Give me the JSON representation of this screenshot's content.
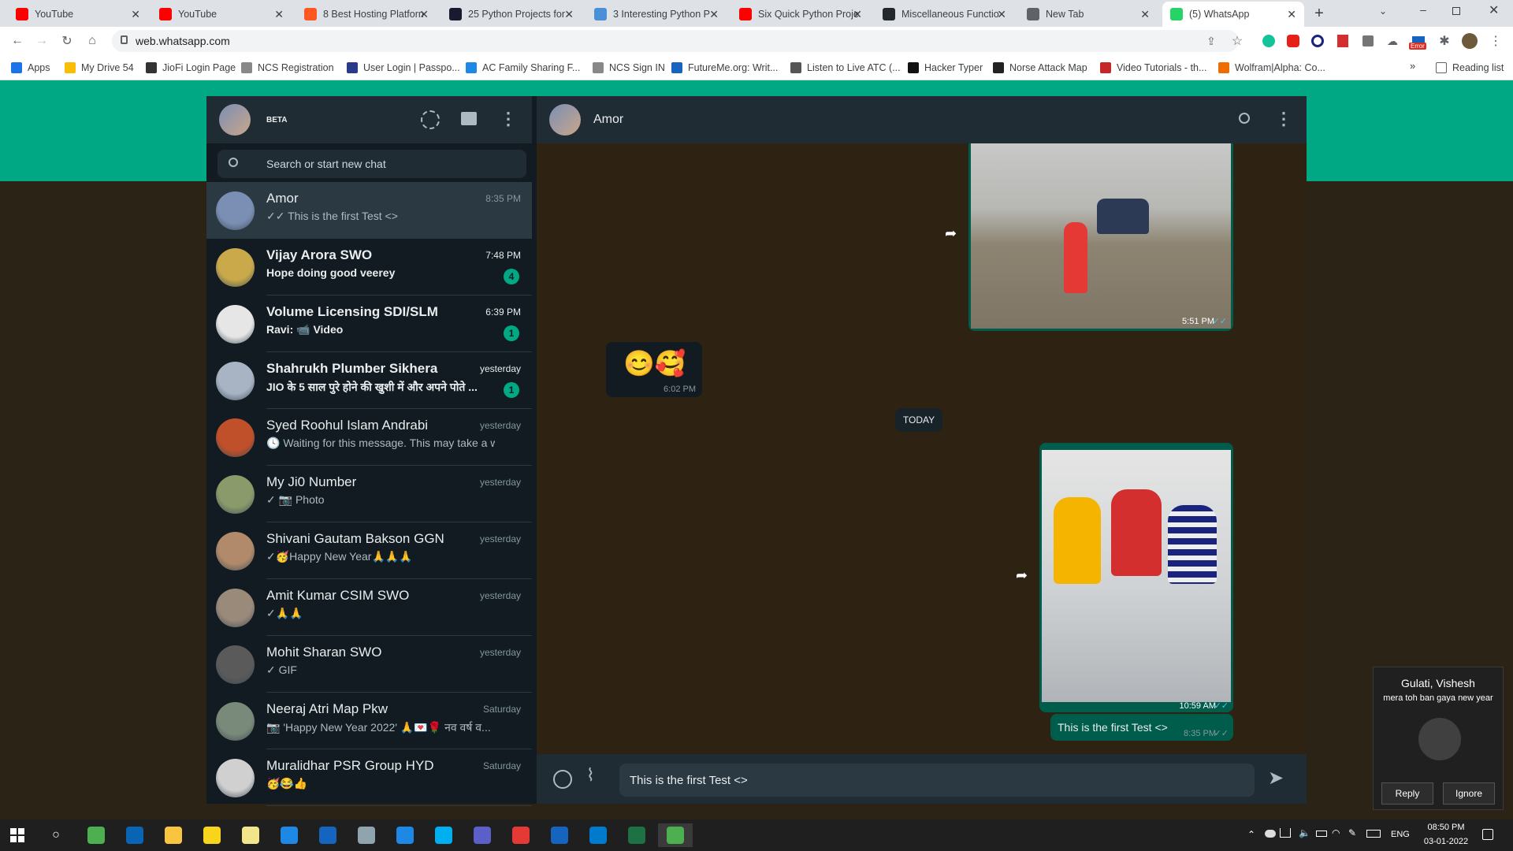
{
  "browser": {
    "tabs": [
      {
        "title": "YouTube",
        "favicon": "youtube-icon",
        "color": "#ff0000"
      },
      {
        "title": "YouTube",
        "favicon": "youtube-icon",
        "color": "#ff0000"
      },
      {
        "title": "8 Best Hosting Platforn",
        "favicon": "hosting-icon",
        "color": "#ff5722"
      },
      {
        "title": "25 Python Projects for",
        "favicon": "python-projects-icon",
        "color": "#1a1a2e"
      },
      {
        "title": "3 Interesting Python P",
        "favicon": "medium-icon",
        "color": "#4a90d9"
      },
      {
        "title": "Six Quick Python Proje",
        "favicon": "youtube-icon",
        "color": "#ff0000"
      },
      {
        "title": "Miscellaneous Functio",
        "favicon": "github-icon",
        "color": "#24292e"
      },
      {
        "title": "New Tab",
        "favicon": "chrome-icon",
        "color": "#5f6368"
      },
      {
        "title": "(5) WhatsApp",
        "favicon": "whatsapp-icon",
        "color": "#25d366"
      }
    ],
    "url": "web.whatsapp.com",
    "bookmarks": [
      {
        "label": "Apps",
        "color": "#1a73e8"
      },
      {
        "label": "My Drive 54",
        "color": "#fbbc04"
      },
      {
        "label": "JioFi Login Page",
        "color": "#333333"
      },
      {
        "label": "NCS Registration",
        "color": "#888888"
      },
      {
        "label": "User Login | Passpo...",
        "color": "#2a3a8a"
      },
      {
        "label": "AC Family Sharing F...",
        "color": "#1e88e5"
      },
      {
        "label": "NCS Sign IN",
        "color": "#888888"
      },
      {
        "label": "FutureMe.org: Writ...",
        "color": "#1565c0"
      },
      {
        "label": "Listen to Live ATC (...",
        "color": "#555555"
      },
      {
        "label": "Hacker Typer",
        "color": "#111111"
      },
      {
        "label": "Norse Attack Map",
        "color": "#222222"
      },
      {
        "label": "Video Tutorials - th...",
        "color": "#c62828"
      },
      {
        "label": "Wolfram|Alpha: Co...",
        "color": "#ef6c00"
      }
    ],
    "reading_list": "Reading list",
    "extension_error_badge": "Error"
  },
  "whatsapp": {
    "beta_label": "BETA",
    "search_placeholder": "Search or start new chat",
    "chats": [
      {
        "name": "Amor",
        "message": "✓✓ This is the first Test <>",
        "time": "8:35 PM",
        "unread": "",
        "bold": false,
        "avatar_color": "#7b8fb5"
      },
      {
        "name": "Vijay Arora SWO",
        "message": "Hope doing good veerey",
        "time": "7:48 PM",
        "unread": "4",
        "bold": true,
        "avatar_color": "#c9a94a"
      },
      {
        "name": "Volume Licensing SDI/SLM",
        "message": "Ravi: 📹 Video",
        "time": "6:39 PM",
        "unread": "1",
        "bold": true,
        "avatar_color": "#e6e6e6"
      },
      {
        "name": "Shahrukh Plumber Sikhera",
        "message": "JIO के 5 साल पुरे होने की खुशी में और अपने पोते ...",
        "time": "yesterday",
        "unread": "1",
        "bold": true,
        "avatar_color": "#a8b4c4"
      },
      {
        "name": "Syed Roohul Islam Andrabi",
        "message": "🕓 Waiting for this message. This may take a while.",
        "time": "yesterday",
        "unread": "",
        "bold": false,
        "avatar_color": "#c0502a"
      },
      {
        "name": "My Ji0 Number",
        "message": "✓ 📷 Photo",
        "time": "yesterday",
        "unread": "",
        "bold": false,
        "avatar_color": "#8a9a6a"
      },
      {
        "name": "Shivani Gautam Bakson GGN",
        "message": "✓🥳Happy New Year🙏🙏🙏",
        "time": "yesterday",
        "unread": "",
        "bold": false,
        "avatar_color": "#b08a6a"
      },
      {
        "name": "Amit Kumar CSIM SWO",
        "message": "✓🙏🙏",
        "time": "yesterday",
        "unread": "",
        "bold": false,
        "avatar_color": "#9a8a7a"
      },
      {
        "name": "Mohit Sharan SWO",
        "message": "✓ GIF",
        "time": "yesterday",
        "unread": "",
        "bold": false,
        "avatar_color": "#5a5a5a"
      },
      {
        "name": "Neeraj Atri Map Pkw",
        "message": "📷 'Happy New Year 2022'   🙏💌🌹 नव वर्ष व...",
        "time": "Saturday",
        "unread": "",
        "bold": false,
        "avatar_color": "#7a8a7a"
      },
      {
        "name": "Muralidhar PSR Group HYD",
        "message": "🥳😂👍",
        "time": "Saturday",
        "unread": "",
        "bold": false,
        "avatar_color": "#d0d0d0"
      }
    ],
    "active_chat": {
      "name": "Amor",
      "messages": {
        "photo1_time": "5:51 PM",
        "emoji_msg": "😊🥰",
        "emoji_time": "6:02 PM",
        "date_divider": "TODAY",
        "photo2_time": "10:59 AM",
        "text_msg": "This is the first Test <>",
        "text_time": "8:35 PM"
      },
      "composer_value": "This is the first Test <>"
    }
  },
  "notification": {
    "sender": "Gulati, Vishesh",
    "message": "mera toh ban gaya new year",
    "reply": "Reply",
    "ignore": "Ignore"
  },
  "taskbar": {
    "language": "ENG",
    "time": "08:50 PM",
    "date": "03-01-2022"
  },
  "colors": {
    "teal": "#00a884",
    "panel": "#111b21",
    "header": "#202c33",
    "outgoing": "#005c4b"
  }
}
